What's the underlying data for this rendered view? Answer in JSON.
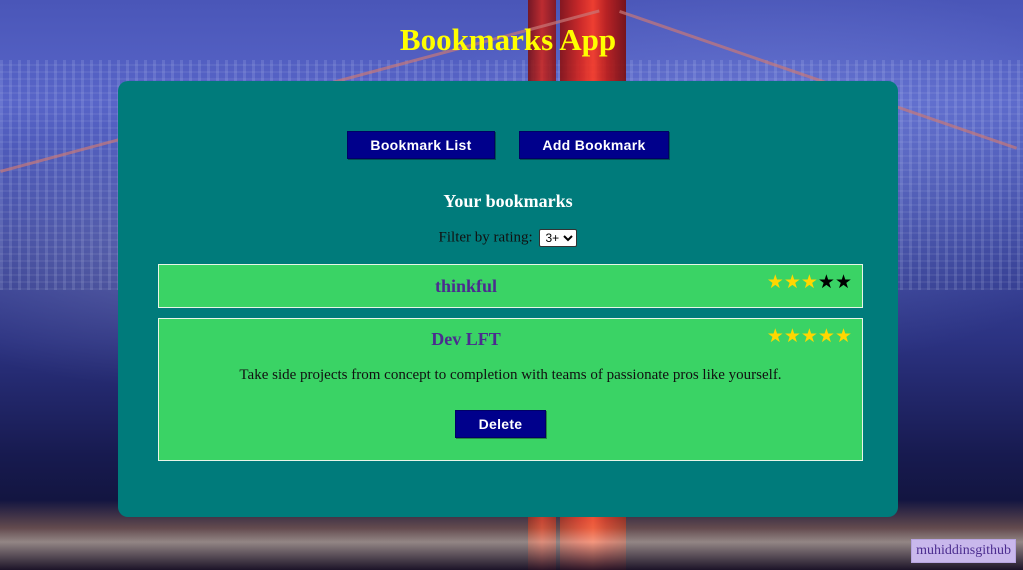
{
  "app": {
    "title": "Bookmarks App"
  },
  "nav": {
    "list_label": "Bookmark List",
    "add_label": "Add Bookmark"
  },
  "list": {
    "heading": "Your bookmarks",
    "filter_label": "Filter by rating:",
    "filter_selected": "3+"
  },
  "bookmarks": [
    {
      "title": "thinkful",
      "rating": 3,
      "max_rating": 5,
      "expanded": false
    },
    {
      "title": "Dev LFT",
      "rating": 5,
      "max_rating": 5,
      "expanded": true,
      "description": "Take side projects from concept to completion with teams of passionate pros like yourself.",
      "delete_label": "Delete"
    }
  ],
  "footer": {
    "badge": "muhiddinsgithub"
  },
  "colors": {
    "title": "#ffff00",
    "panel": "#007b7b",
    "button": "#00008b",
    "card": "#3ad365",
    "card_title": "#4b2c8f",
    "star_filled": "#ffd700",
    "star_empty": "#000000"
  },
  "icons": {
    "star": "star-icon"
  }
}
